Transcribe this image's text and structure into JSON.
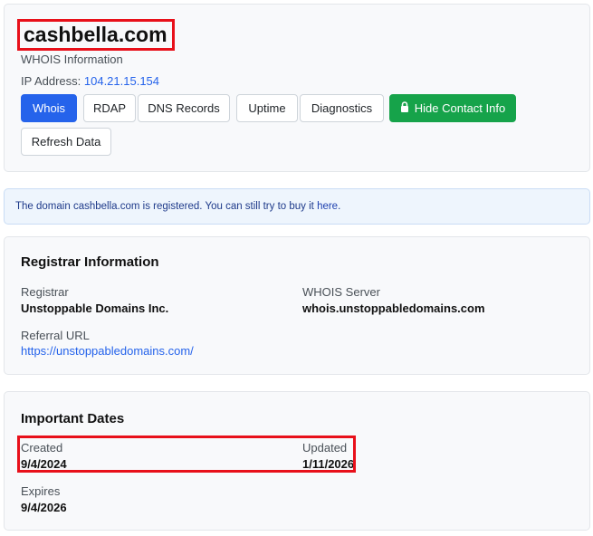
{
  "header": {
    "domain": "cashbella.com",
    "subtitle": "WHOIS Information",
    "ip_label": "IP Address:",
    "ip_value": "104.21.15.154"
  },
  "buttons": {
    "whois": "Whois",
    "rdap": "RDAP",
    "dns": "DNS Records",
    "uptime": "Uptime",
    "diagnostics": "Diagnostics",
    "hide_contact": "Hide Contact Info",
    "refresh": "Refresh Data"
  },
  "alert": {
    "prefix": "The domain ",
    "domain": "cashbella.com",
    "middle": " is registered. You can still try to buy it ",
    "link": "here",
    "suffix": "."
  },
  "registrar": {
    "title": "Registrar Information",
    "registrar_label": "Registrar",
    "registrar_value": "Unstoppable Domains Inc.",
    "whois_server_label": "WHOIS Server",
    "whois_server_value": "whois.unstoppabledomains.com",
    "referral_label": "Referral URL",
    "referral_value": "https://unstoppabledomains.com/"
  },
  "dates": {
    "title": "Important Dates",
    "created_label": "Created",
    "created_value": "9/4/2024",
    "updated_label": "Updated",
    "updated_value": "1/11/2026",
    "expires_label": "Expires",
    "expires_value": "9/4/2026"
  },
  "colors": {
    "primary": "#2563eb",
    "success": "#16a34a",
    "highlight": "#e8101a"
  },
  "icons": {
    "lock": "lock-icon"
  }
}
